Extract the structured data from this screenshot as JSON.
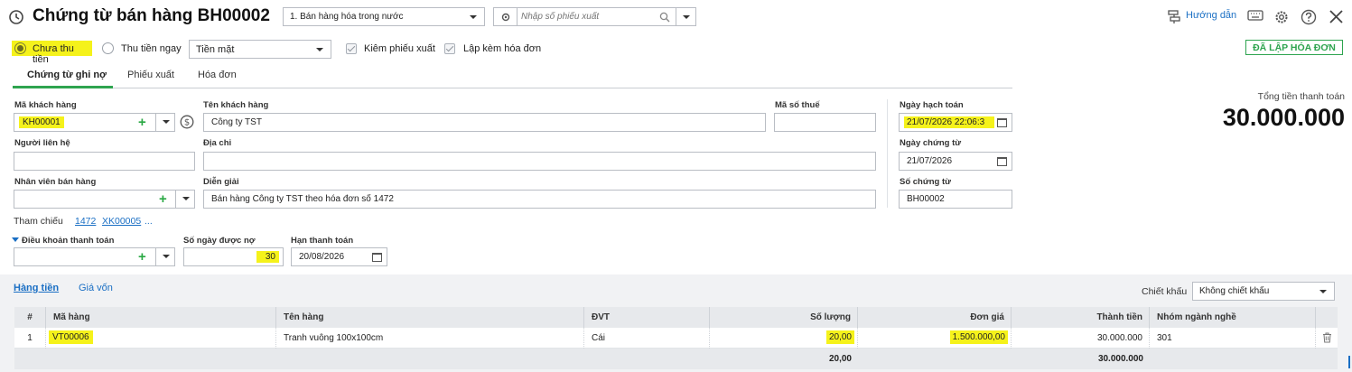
{
  "header": {
    "title": "Chứng từ bán hàng BH00002",
    "sale_type": "1. Bán hàng hóa trong nước",
    "search_placeholder": "Nhập số phiếu xuất",
    "help_label": "Hướng dẫn"
  },
  "options": {
    "unpaid_label": "Chưa thu tiền",
    "paid_label": "Thu tiền ngay",
    "payment_method": "Tiền mặt",
    "export_slip_label": "Kiêm phiếu xuất",
    "invoice_label": "Lập kèm hóa đơn",
    "status_badge": "ĐÃ LẬP HÓA ĐƠN"
  },
  "tabs": [
    "Chứng từ ghi nợ",
    "Phiếu xuất",
    "Hóa đơn"
  ],
  "form": {
    "customer_code_label": "Mã khách hàng",
    "customer_code": "KH00001",
    "customer_name_label": "Tên khách hàng",
    "customer_name": "Công ty TST",
    "tax_code_label": "Mã số thuế",
    "tax_code": "",
    "contact_label": "Người liên hệ",
    "contact": "",
    "address_label": "Địa chỉ",
    "address": "",
    "salesperson_label": "Nhân viên bán hàng",
    "salesperson": "",
    "description_label": "Diễn giải",
    "description": "Bán hàng Công ty TST theo hóa đơn số 1472",
    "posting_date_label": "Ngày hạch toán",
    "posting_date": "21/07/2026 22:06:3",
    "voucher_date_label": "Ngày chứng từ",
    "voucher_date": "21/07/2026",
    "voucher_no_label": "Số chứng từ",
    "voucher_no": "BH00002",
    "reference_label": "Tham chiếu",
    "references": [
      "1472",
      "XK00005",
      "..."
    ],
    "payment_terms_label": "Điều khoản thanh toán",
    "payment_terms": "",
    "credit_days_label": "Số ngày được nợ",
    "credit_days": "30",
    "due_date_label": "Hạn thanh toán",
    "due_date": "20/08/2026"
  },
  "total": {
    "label": "Tổng tiền thanh toán",
    "value": "30.000.000"
  },
  "detail": {
    "tabs": [
      "Hàng tiền",
      "Giá vốn"
    ],
    "discount_label": "Chiết khấu",
    "discount_value": "Không chiết khấu",
    "columns": [
      "#",
      "Mã hàng",
      "Tên hàng",
      "ĐVT",
      "Số lượng",
      "Đơn giá",
      "Thành tiền",
      "Nhóm ngành nghề"
    ],
    "rows": [
      {
        "no": "1",
        "code": "VT00006",
        "name": "Tranh vuông 100x100cm",
        "unit": "Cái",
        "qty": "20,00",
        "price": "1.500.000,00",
        "amount": "30.000.000",
        "industry": "301"
      }
    ],
    "footer": {
      "qty": "20,00",
      "amount": "30.000.000"
    }
  }
}
